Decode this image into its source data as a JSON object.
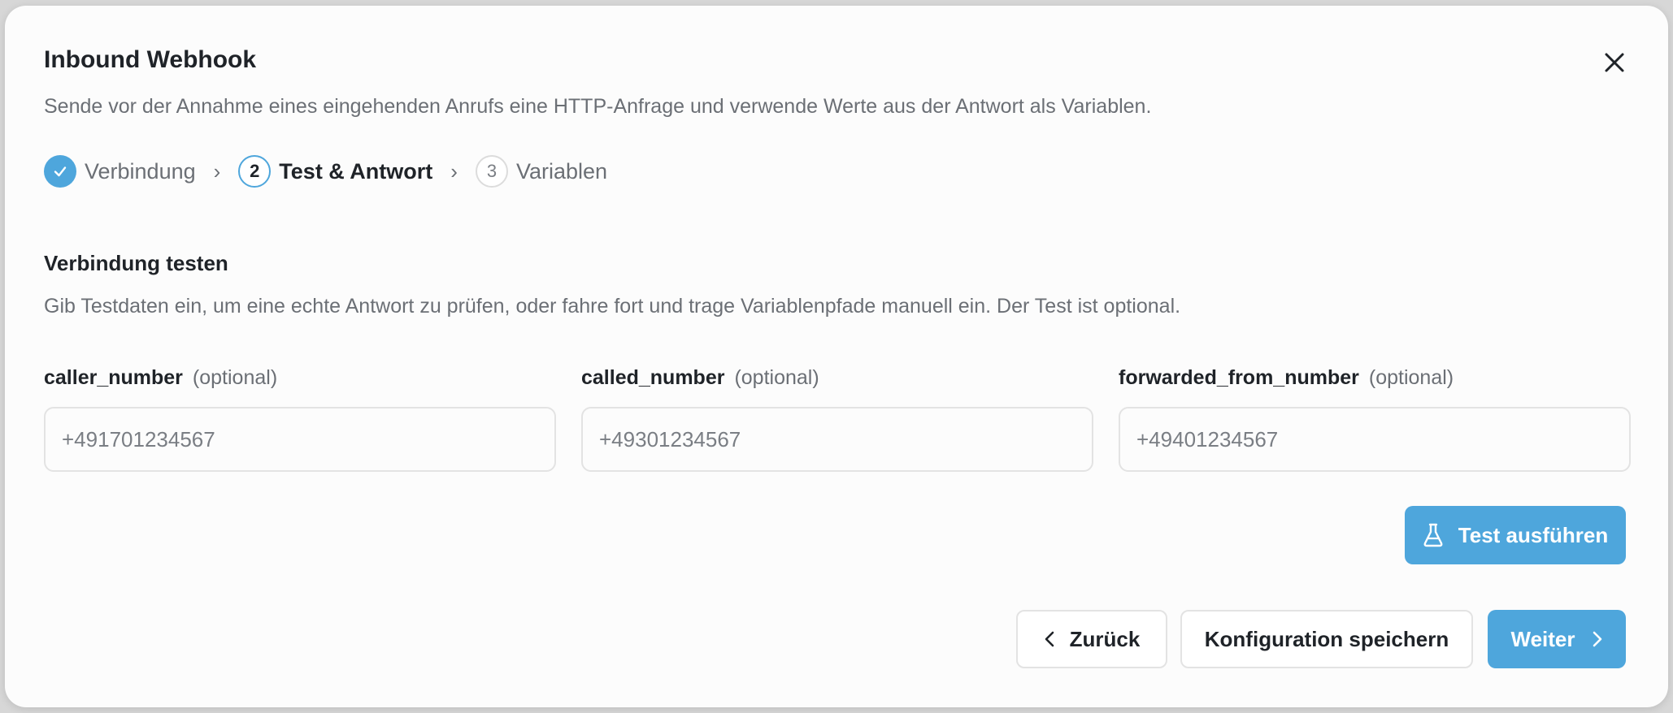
{
  "dialog": {
    "title": "Inbound Webhook",
    "subtitle": "Sende vor der Annahme eines eingehenden Anrufs eine HTTP-Anfrage und verwende Werte aus der Antwort als Variablen."
  },
  "stepper": {
    "steps": [
      {
        "number": "1",
        "label": "Verbindung",
        "state": "done"
      },
      {
        "number": "2",
        "label": "Test & Antwort",
        "state": "active"
      },
      {
        "number": "3",
        "label": "Variablen",
        "state": "pending"
      }
    ],
    "separator": "›"
  },
  "section": {
    "title": "Verbindung testen",
    "description": "Gib Testdaten ein, um eine echte Antwort zu prüfen, oder fahre fort und trage Variablenpfade manuell ein. Der Test ist optional."
  },
  "fields": [
    {
      "name": "caller_number",
      "optional": "(optional)",
      "placeholder": "+491701234567"
    },
    {
      "name": "called_number",
      "optional": "(optional)",
      "placeholder": "+49301234567"
    },
    {
      "name": "forwarded_from_number",
      "optional": "(optional)",
      "placeholder": "+49401234567"
    }
  ],
  "buttons": {
    "run_test": "Test ausführen",
    "back": "Zurück",
    "save": "Konfiguration speichern",
    "next": "Weiter"
  },
  "colors": {
    "accent": "#4ea6dc",
    "text": "#1f2328",
    "muted": "#6b6f75",
    "border": "#e3e3e3"
  },
  "icons": {
    "close": "close-icon",
    "done": "checkmark-icon",
    "flask": "flask-icon",
    "back": "chevron-left-icon",
    "next": "chevron-right-icon"
  }
}
